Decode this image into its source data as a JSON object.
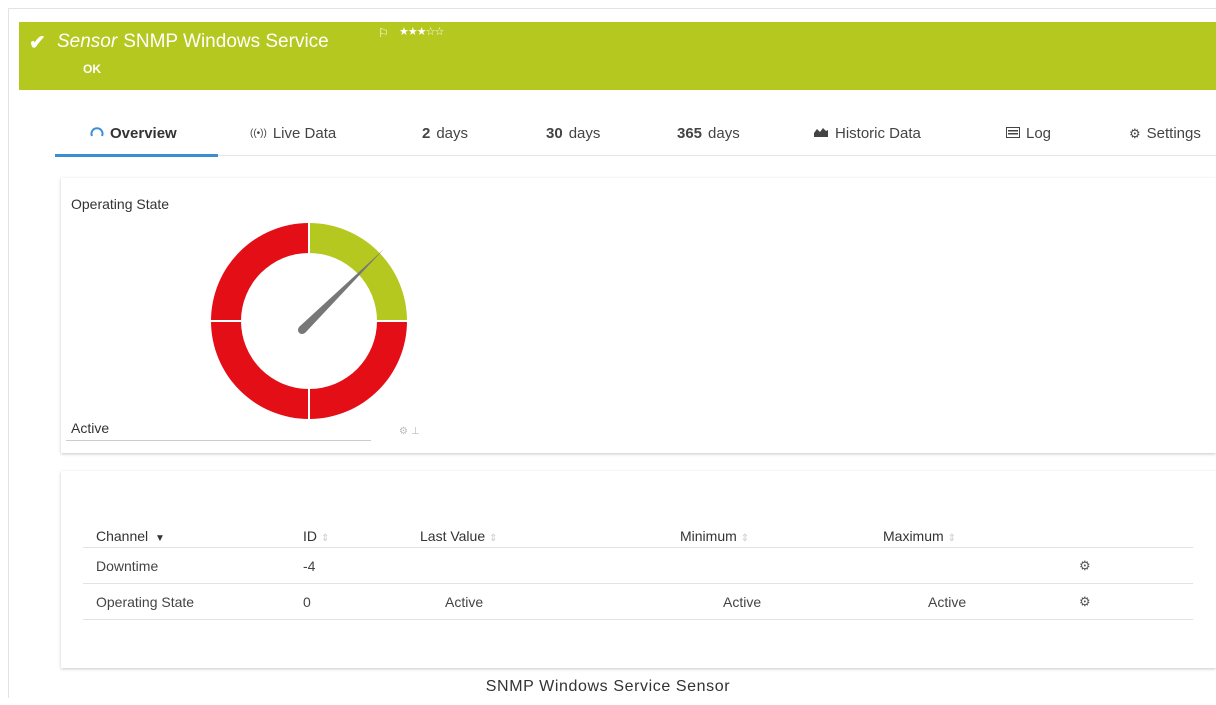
{
  "header": {
    "kind": "Sensor",
    "name": "SNMP Windows Service",
    "status": "OK",
    "stars": "★★★☆☆",
    "color": "#b5c81f"
  },
  "tabs": [
    {
      "icon": "gauge-icon",
      "label": "Overview"
    },
    {
      "icon": "live-data-icon",
      "label": "Live Data"
    },
    {
      "num": "2",
      "label": "days"
    },
    {
      "num": "30",
      "label": "days"
    },
    {
      "num": "365",
      "label": "days"
    },
    {
      "icon": "area-chart-icon",
      "label": "Historic Data"
    },
    {
      "icon": "log-icon",
      "label": "Log"
    },
    {
      "icon": "gear-icon",
      "label": "Settings"
    }
  ],
  "gauge": {
    "title": "Operating State",
    "value_text": "Active"
  },
  "table": {
    "columns": [
      "Channel",
      "ID",
      "Last Value",
      "Minimum",
      "Maximum"
    ],
    "rows": [
      {
        "channel": "Downtime",
        "id": "-4",
        "last": "",
        "min": "",
        "max": ""
      },
      {
        "channel": "Operating State",
        "id": "0",
        "last": "Active",
        "min": "Active",
        "max": "Active"
      }
    ]
  },
  "caption": "SNMP Windows Service Sensor",
  "colors": {
    "accent": "#3a8fd4",
    "ok": "#b5c81f",
    "error": "#e30e16"
  }
}
